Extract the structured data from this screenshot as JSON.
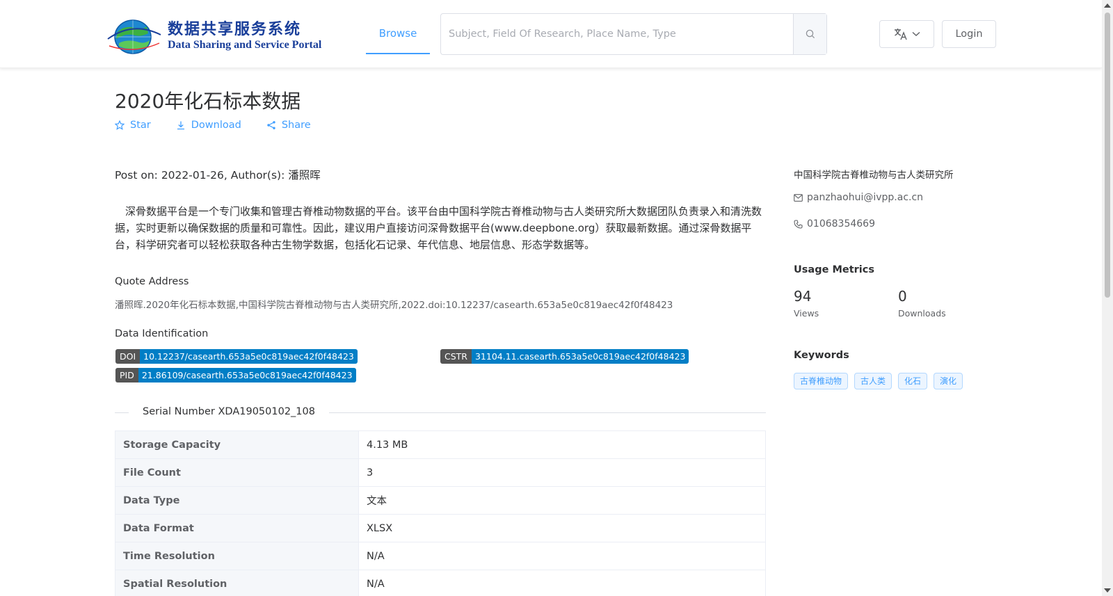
{
  "header": {
    "logo_cn": "数据共享服务系统",
    "logo_en": "Data Sharing and Service Portal",
    "nav_browse": "Browse",
    "search_placeholder": "Subject, Field Of Research, Place Name, Type",
    "login": "Login",
    "accent": "#409eff"
  },
  "dataset": {
    "title": "2020年化石标本数据",
    "actions": {
      "star": "Star",
      "download": "Download",
      "share": "Share"
    },
    "post_on": "Post on: 2022-01-26, Author(s): 潘照晖",
    "description": "深骨数据平台是一个专门收集和管理古脊椎动物数据的平台。该平台由中国科学院古脊椎动物与古人类研究所大数据团队负责录入和清洗数据，实时更新以确保数据的质量和可靠性。因此，建议用户直接访问深骨数据平台(www.deepbone.org）获取最新数据。通过深骨数据平台，科学研究者可以轻松获取各种古生物学数据，包括化石记录、年代信息、地层信息、形态学数据等。",
    "quote_label": "Quote Address",
    "quote_text": "潘照晖.2020年化石标本数据,中国科学院古脊椎动物与古人类研究所,2022.doi:10.12237/casearth.653a5e0c819aec42f0f48423",
    "identification_label": "Data Identification",
    "identifiers": [
      {
        "key": "DOI",
        "value": "10.12237/casearth.653a5e0c819aec42f0f48423"
      },
      {
        "key": "CSTR",
        "value": "31104.11.casearth.653a5e0c819aec42f0f48423"
      },
      {
        "key": "PID",
        "value": "21.86109/casearth.653a5e0c819aec42f0f48423"
      }
    ],
    "serial_number": "Serial Number XDA19050102_108",
    "info_rows": [
      {
        "key": "Storage Capacity",
        "value": "4.13 MB"
      },
      {
        "key": "File Count",
        "value": "3"
      },
      {
        "key": "Data Type",
        "value": "文本"
      },
      {
        "key": "Data Format",
        "value": "XLSX"
      },
      {
        "key": "Time Resolution",
        "value": "N/A"
      },
      {
        "key": "Spatial Resolution",
        "value": "N/A"
      }
    ]
  },
  "sidebar": {
    "institution": "中国科学院古脊椎动物与古人类研究所",
    "email": "panzhaohui@ivpp.ac.cn",
    "phone": "01068354669",
    "usage_heading": "Usage Metrics",
    "views": "94",
    "views_label": "Views",
    "downloads": "0",
    "downloads_label": "Downloads",
    "keywords_heading": "Keywords",
    "keywords": [
      "古脊椎动物",
      "古人类",
      "化石",
      "演化"
    ]
  }
}
